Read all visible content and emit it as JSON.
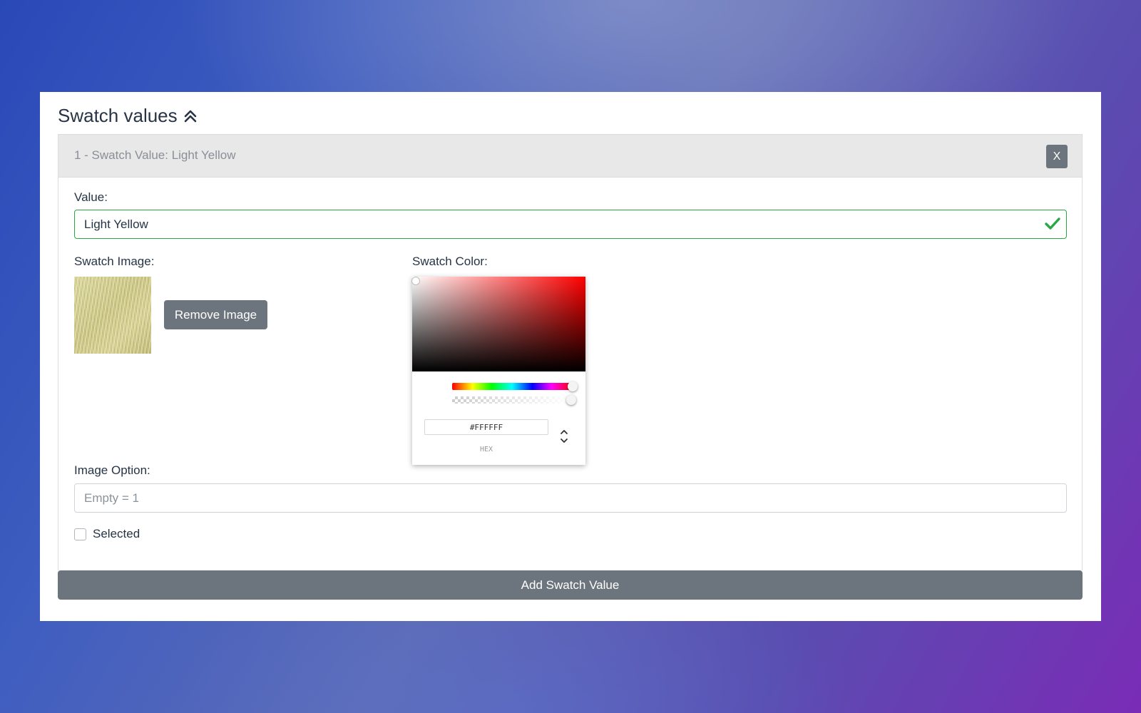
{
  "section": {
    "title": "Swatch values",
    "toggle_icon": "chevron-double-up-icon"
  },
  "swatch_value": {
    "header": "1 - Swatch Value: Light Yellow",
    "close_label": "X",
    "value_label": "Value:",
    "value": "Light Yellow",
    "value_valid": true,
    "image_label": "Swatch Image:",
    "remove_image_label": "Remove Image",
    "color_label": "Swatch Color:",
    "color_picker": {
      "hex_value": "#FFFFFF",
      "mode_label": "HEX",
      "hue_color": "#FF0000",
      "alpha": 1.0
    },
    "image_option_label": "Image Option:",
    "image_option_value": "",
    "image_option_placeholder": "Empty = 1",
    "selected_label": "Selected",
    "selected_checked": false
  },
  "add_swatch_label": "Add Swatch Value",
  "colors": {
    "button_gray": "#6c757d",
    "valid_green": "#28a745",
    "header_gray": "#e8e8e8",
    "swatch_yellow": "#cfca8a"
  }
}
